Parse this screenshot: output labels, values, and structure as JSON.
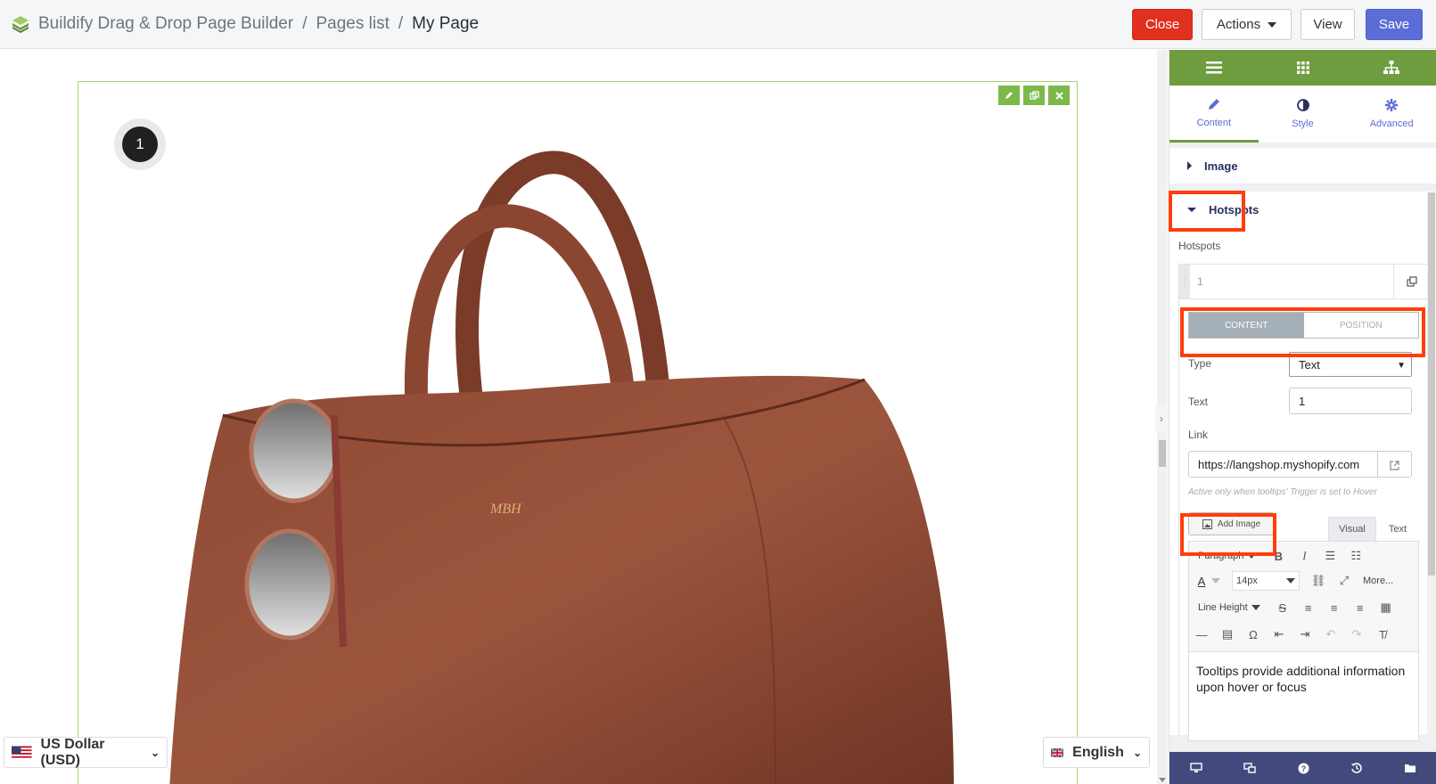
{
  "header": {
    "crumbs": [
      "Buildify Drag & Drop Page Builder",
      "Pages list",
      "My Page"
    ],
    "separators": [
      "/",
      "/"
    ],
    "buttons": {
      "close": "Close",
      "actions": "Actions",
      "view": "View",
      "save": "Save"
    }
  },
  "canvas": {
    "hotspot_label": "1",
    "bag_monogram": "MBH",
    "currency": "US Dollar (USD)",
    "language": "English"
  },
  "panel": {
    "tabs": [
      "Content",
      "Style",
      "Advanced"
    ],
    "sections": {
      "image": "Image",
      "hotspots": "Hotspots"
    },
    "hotspots_label": "Hotspots",
    "repeater_item": "1",
    "segments": [
      "CONTENT",
      "POSITION"
    ],
    "type_label": "Type",
    "type_value": "Text",
    "text_label": "Text",
    "text_value": "1",
    "link_label": "Link",
    "link_value": "https://langshop.myshopify.com",
    "hint": "Active only when tooltips' Trigger is set to Hover",
    "add_image": "Add Image",
    "editor_tabs": [
      "Visual",
      "Text"
    ],
    "paragraph": "Paragraph",
    "font_size": "14px",
    "more": "More...",
    "line_height": "Line Height",
    "editor_content": "Tooltips provide additional information upon hover or focus"
  },
  "colors": {
    "accent_green": "#6f9c3e",
    "close_red": "#e0301e",
    "save_blue": "#5b6dd6",
    "highlight": "#ff3d0a",
    "panel_bottom": "#44497d"
  }
}
